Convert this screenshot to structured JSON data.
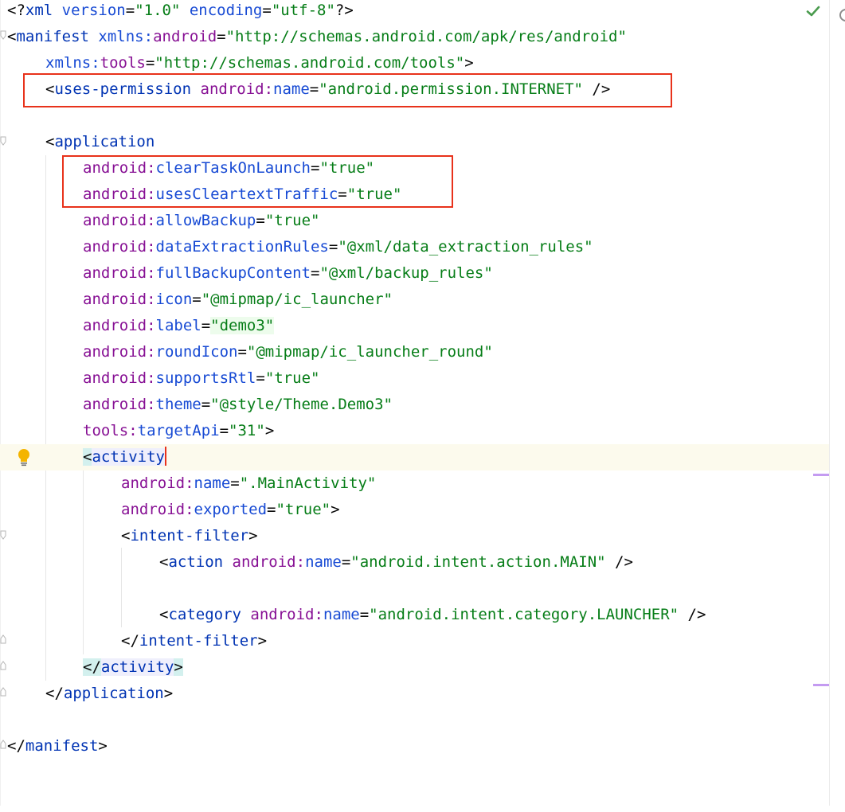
{
  "editor": {
    "file_type": "AndroidManifest.xml",
    "lines": {
      "l1": {
        "open": "<?",
        "name": "xml",
        "attr1": "version",
        "val1": "\"1.0\"",
        "attr2": "encoding",
        "val2": "\"utf-8\"",
        "close": "?>"
      },
      "l2": {
        "open": "<",
        "tag": "manifest",
        "ns": "xmlns:",
        "attr": "android",
        "eq": "=",
        "val": "\"http://schemas.android.com/apk/res/android\""
      },
      "l3": {
        "ns": "xmlns:",
        "attr": "tools",
        "eq": "=",
        "val": "\"http://schemas.android.com/tools\"",
        "close": ">"
      },
      "l4": {
        "open": "<",
        "tag": "uses-permission",
        "ns": "android:",
        "attr": "name",
        "eq": "=",
        "val": "\"android.permission.INTERNET\"",
        "close": "/>"
      },
      "l6": {
        "open": "<",
        "tag": "application"
      },
      "l7": {
        "ns": "android:",
        "attr": "clearTaskOnLaunch",
        "eq": "=",
        "val": "\"true\""
      },
      "l8": {
        "ns": "android:",
        "attr": "usesCleartextTraffic",
        "eq": "=",
        "val": "\"true\""
      },
      "l9": {
        "ns": "android:",
        "attr": "allowBackup",
        "eq": "=",
        "val": "\"true\""
      },
      "l10": {
        "ns": "android:",
        "attr": "dataExtractionRules",
        "eq": "=",
        "val": "\"@xml/data_extraction_rules\""
      },
      "l11": {
        "ns": "android:",
        "attr": "fullBackupContent",
        "eq": "=",
        "val": "\"@xml/backup_rules\""
      },
      "l12": {
        "ns": "android:",
        "attr": "icon",
        "eq": "=",
        "val": "\"@mipmap/ic_launcher\""
      },
      "l13": {
        "ns": "android:",
        "attr": "label",
        "eq": "=",
        "val": "\"demo3\""
      },
      "l14": {
        "ns": "android:",
        "attr": "roundIcon",
        "eq": "=",
        "val": "\"@mipmap/ic_launcher_round\""
      },
      "l15": {
        "ns": "android:",
        "attr": "supportsRtl",
        "eq": "=",
        "val": "\"true\""
      },
      "l16": {
        "ns": "android:",
        "attr": "theme",
        "eq": "=",
        "val": "\"@style/Theme.Demo3\""
      },
      "l17": {
        "ns": "tools:",
        "attr": "targetApi",
        "eq": "=",
        "val": "\"31\"",
        "close": ">"
      },
      "l18": {
        "open": "<",
        "tag": "activity"
      },
      "l19": {
        "ns": "android:",
        "attr": "name",
        "eq": "=",
        "val": "\".MainActivity\""
      },
      "l20": {
        "ns": "android:",
        "attr": "exported",
        "eq": "=",
        "val": "\"true\"",
        "close": ">"
      },
      "l21": {
        "open": "<",
        "tag": "intent-filter",
        "close": ">"
      },
      "l22": {
        "open": "<",
        "tag": "action",
        "ns": "android:",
        "attr": "name",
        "eq": "=",
        "val": "\"android.intent.action.MAIN\"",
        "close": "/>"
      },
      "l24": {
        "open": "<",
        "tag": "category",
        "ns": "android:",
        "attr": "name",
        "eq": "=",
        "val": "\"android.intent.category.LAUNCHER\"",
        "close": "/>"
      },
      "l25": {
        "open": "</",
        "tag": "intent-filter",
        "close": ">"
      },
      "l26": {
        "open": "</",
        "tag": "activity",
        "close": ">"
      },
      "l27": {
        "open": "</",
        "tag": "application",
        "close": ">"
      },
      "l29": {
        "open": "</",
        "tag": "manifest",
        "close": ">"
      }
    }
  },
  "colors": {
    "tag": "#0033b3",
    "namespace": "#871094",
    "attribute": "#174ad4",
    "value": "#067d17",
    "annotation_box": "#e8321b",
    "current_line": "#fcfaed"
  },
  "icons": {
    "inspection_ok": "check-icon",
    "intention_bulb": "lightbulb-icon"
  }
}
